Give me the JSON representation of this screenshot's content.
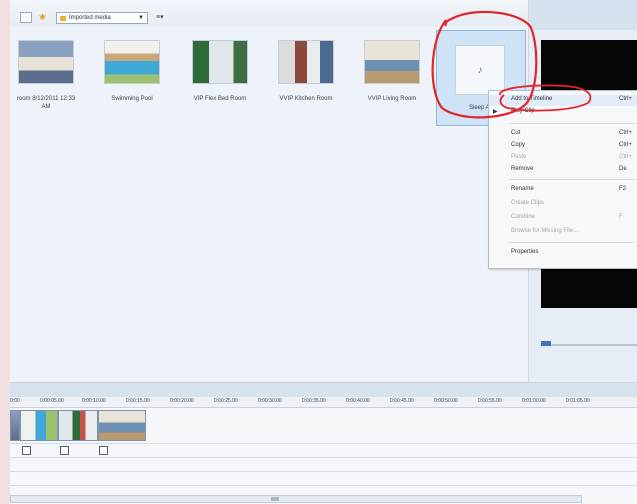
{
  "toolbar": {
    "collection_label": "Imported media"
  },
  "clips": [
    {
      "caption": "room 8/12/2011 12:33",
      "caption2": "AM",
      "icon": "bedroom-photo"
    },
    {
      "caption": "Swimming Pool",
      "icon": "pool-photo"
    },
    {
      "caption": "VIP Flex Bed Room",
      "icon": "flexbed-photo"
    },
    {
      "caption": "VVIP Kitchen Room",
      "icon": "kitchen-photo"
    },
    {
      "caption": "VVIP Living Room",
      "icon": "living-photo"
    },
    {
      "caption": "Sleep Au",
      "icon": "audio-file-icon"
    }
  ],
  "context_menu": {
    "items": [
      {
        "label": "Add to Timeline",
        "shortcut": "Ctrl+",
        "disabled": false
      },
      {
        "label": "Play Clip",
        "shortcut": "",
        "disabled": false
      },
      {
        "label": "Cut",
        "shortcut": "Ctrl+",
        "disabled": false
      },
      {
        "label": "Copy",
        "shortcut": "Ctrl+",
        "disabled": false
      },
      {
        "label": "Paste",
        "shortcut": "Ctrl+",
        "disabled": true
      },
      {
        "label": "Remove",
        "shortcut": "De",
        "disabled": false
      },
      {
        "label": "Rename",
        "shortcut": "F2",
        "disabled": false
      },
      {
        "label": "Create Clips",
        "shortcut": "",
        "disabled": true
      },
      {
        "label": "Combine",
        "shortcut": "F",
        "disabled": true
      },
      {
        "label": "Browse for Missing File...",
        "shortcut": "",
        "disabled": true
      },
      {
        "label": "Properties",
        "shortcut": "",
        "disabled": false
      }
    ]
  },
  "timeline": {
    "ticks": [
      "0:00",
      "0:00:05.00",
      "0:00:10.00",
      "0:00:15.00",
      "0:00:20.00",
      "0:00:25.00",
      "0:00:30.00",
      "0:00:35.00",
      "0:00:40.00",
      "0:00:45.00",
      "0:00:50.00",
      "0:00:55.00",
      "0:01:00.00",
      "0:01:05.00"
    ]
  },
  "colors": {
    "annotation": "#e0262b",
    "selection": "#cfe3f7",
    "preview_screen": "#050505"
  }
}
